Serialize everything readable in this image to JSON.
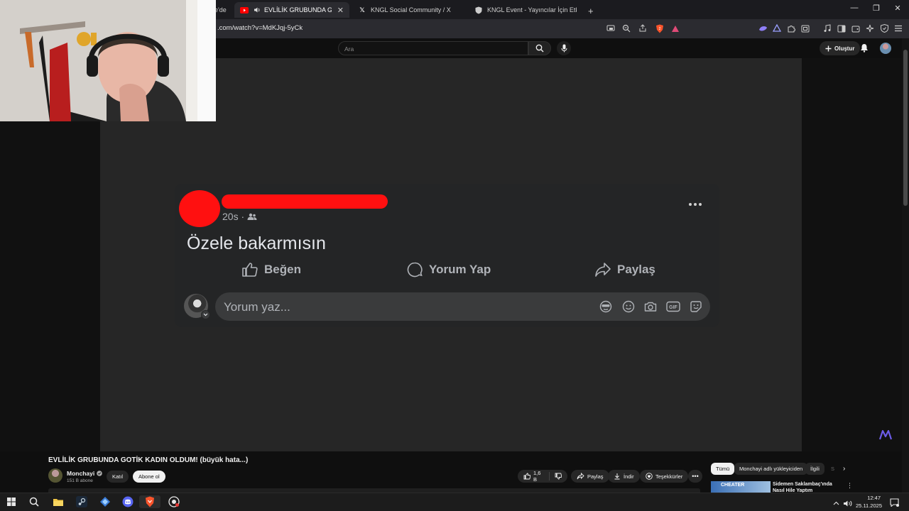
{
  "browser": {
    "tabs": [
      {
        "label": "e'de",
        "active": false
      },
      {
        "label": "EVLİLİK GRUBUNDA GOTİK KA",
        "active": true
      },
      {
        "label": "KNGL Social Community / X",
        "active": false
      },
      {
        "label": "KNGL Event - Yayıncılar İçin Etkinlik ve",
        "active": false
      }
    ],
    "new_tab": "+",
    "url": ".com/watch?v=MdKJqj-5yCk",
    "window_controls": {
      "minimize": "—",
      "restore": "❐",
      "close": "✕"
    }
  },
  "youtube": {
    "search_placeholder": "Ara",
    "create_label": "Oluştur",
    "video_title": "EVLİLİK GRUBUNDA GOTİK KADIN OLDUM! (büyük hata...)",
    "channel_name": "Monchayi",
    "subscribers": "151 B abone",
    "join_label": "Katıl",
    "subscribe_label": "Abone ol",
    "like_count": "1,6 B",
    "share_label": "Paylaş",
    "download_label": "İndir",
    "thanks_label": "Teşekkürler",
    "chips": [
      "Tümü",
      "Monchayi adlı yükleyiciden",
      "İlgili",
      "S"
    ],
    "rec_thumb_text": "CHEATER",
    "rec_title": "Sidemen Saklambaç'ında Nasıl Hile Yaptım"
  },
  "post": {
    "time": "20s ·",
    "text": "Özele bakarmısın",
    "like_label": "Beğen",
    "comment_label": "Yorum Yap",
    "share_label": "Paylaş",
    "comment_placeholder": "Yorum yaz...",
    "gif_label": "GIF",
    "redaction_color": "#ff1010"
  },
  "taskbar": {
    "time": "12:47",
    "date": "25.11.2025"
  },
  "colors": {
    "youtube_bg": "#0f0f0f",
    "fb_card": "#242526",
    "fb_input": "#3a3b3c",
    "redaction": "#ff1010"
  }
}
